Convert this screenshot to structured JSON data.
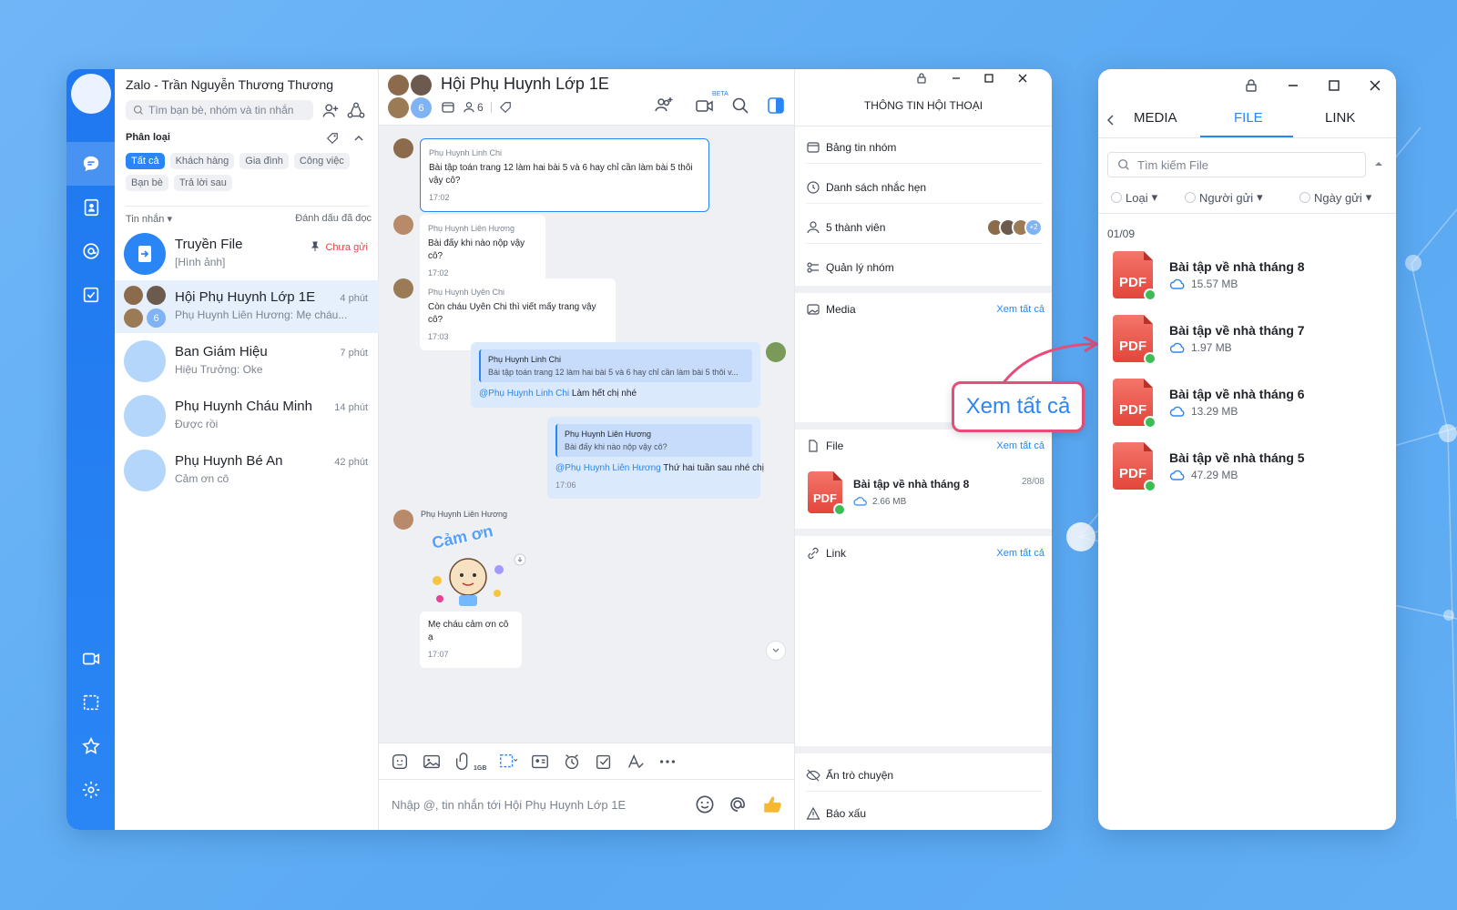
{
  "app": {
    "title": "Zalo - Trần Nguyễn Thương Thương"
  },
  "search": {
    "placeholder": "Tìm bạn bè, nhóm và tin nhắn"
  },
  "categories": {
    "label": "Phân loại",
    "chips": [
      "Tất cả",
      "Khách hàng",
      "Gia đình",
      "Công việc",
      "Bạn bè",
      "Trả lời sau"
    ]
  },
  "list": {
    "header": "Tin nhắn",
    "mark_read": "Đánh dấu đã đọc"
  },
  "conversations": [
    {
      "name": "Truyền File",
      "preview": "[Hình ảnh]",
      "time": "",
      "status": "Chưa gửi"
    },
    {
      "name": "Hội Phụ Huynh Lớp 1E",
      "preview": "Phụ Huynh Liên Hương: Mẹ cháu...",
      "time": "4 phút",
      "badge": "6"
    },
    {
      "name": "Ban Giám Hiệu",
      "preview": "Hiệu Trưởng: Oke",
      "time": "7 phút"
    },
    {
      "name": "Phụ Huynh Cháu Minh",
      "preview": "Được rồi",
      "time": "14 phút"
    },
    {
      "name": "Phụ Huynh Bé An",
      "preview": "Cảm ơn cô",
      "time": "42 phút"
    }
  ],
  "chat": {
    "title": "Hội Phụ Huynh Lớp 1E",
    "member_badge": "6",
    "member_count": "6",
    "beta": "BETA",
    "messages": {
      "m1_sender": "Phụ Huynh Linh Chi",
      "m1_text": "Bài tập toán trang 12 làm hai bài 5 và 6 hay chỉ cần làm bài 5 thôi vậy cô?",
      "m1_time": "17:02",
      "m2_sender": "Phụ Huynh Liên Hương",
      "m2_text": "Bài đấy khi nào nộp vậy cô?",
      "m2_time": "17:02",
      "m3_sender": "Phụ Huynh Uyên Chi",
      "m3_text": "Còn cháu Uyên Chi thì viết mấy trang vậy cô?",
      "m3_time": "17:03",
      "m4_quote_sender": "Phụ Huynh Linh Chi",
      "m4_quote_text": "Bài tập toán trang 12 làm hai bài 5 và 6 hay chỉ cần làm bài 5 thôi v...",
      "m4_mention": "@Phụ Huynh Linh Chi",
      "m4_text": " Làm hết chị nhé",
      "m5_quote_sender": "Phụ Huynh Liên Hương",
      "m5_quote_text": "Bài đấy khi nào nộp vậy cô?",
      "m5_mention": "@Phụ Huynh Liên Hương",
      "m5_text": " Thứ hai tuần sau nhé chị",
      "m5_time": "17:06",
      "m6_sender": "Phụ Huynh Liên Hương",
      "m6_sticker": "Cảm ơn",
      "m7_text": "Mẹ cháu cảm ơn cô ạ",
      "m7_time": "17:07"
    },
    "composer_placeholder": "Nhập @, tin nhắn tới Hội Phụ Huynh Lớp 1E",
    "file_tool_label": "1GB"
  },
  "info": {
    "title": "THÔNG TIN HỘI THOẠI",
    "rows": [
      "Bảng tin nhóm",
      "Danh sách nhắc hẹn",
      "5 thành viên",
      "Quản lý nhóm"
    ],
    "members_more": "+2",
    "media": "Media",
    "file": "File",
    "link": "Link",
    "see_all": "Xem tất cả",
    "file_item": {
      "name": "Bài tập về nhà tháng 8",
      "size": "2.66 MB",
      "date": "28/08"
    },
    "hide_chat": "Ẩn trò chuyện",
    "report": "Báo xấu"
  },
  "callout": "Xem tất cả",
  "file_window": {
    "tabs": [
      "MEDIA",
      "FILE",
      "LINK"
    ],
    "search_placeholder": "Tìm kiếm File",
    "filters": [
      "Loại",
      "Người gửi",
      "Ngày gửi"
    ],
    "date": "01/09",
    "files": [
      {
        "name": "Bài tập về nhà tháng 8",
        "size": "15.57 MB"
      },
      {
        "name": "Bài tập về nhà tháng 7",
        "size": "1.97 MB"
      },
      {
        "name": "Bài tập về nhà tháng 6",
        "size": "13.29 MB"
      },
      {
        "name": "Bài tập về nhà tháng 5",
        "size": "47.29 MB"
      }
    ],
    "pdf_label": "PDF"
  },
  "colors": {
    "accent": "#2a86f4",
    "nav": "#1f78f0",
    "alert": "#e0454a",
    "callout_border": "#e84d79"
  }
}
